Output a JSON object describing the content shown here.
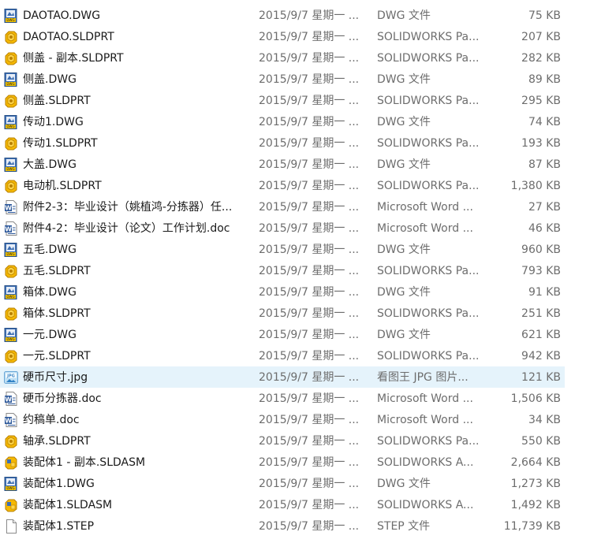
{
  "files": [
    {
      "name": "DAOTAO.DWG",
      "date": "2015/9/7 星期一 ...",
      "type": "DWG 文件",
      "size": "75 KB",
      "icon": "dwg-file-icon"
    },
    {
      "name": "DAOTAO.SLDPRT",
      "date": "2015/9/7 星期一 ...",
      "type": "SOLIDWORKS Pa...",
      "size": "207 KB",
      "icon": "solidworks-part-icon"
    },
    {
      "name": "侧盖 - 副本.SLDPRT",
      "date": "2015/9/7 星期一 ...",
      "type": "SOLIDWORKS Pa...",
      "size": "282 KB",
      "icon": "solidworks-part-icon"
    },
    {
      "name": "侧盖.DWG",
      "date": "2015/9/7 星期一 ...",
      "type": "DWG 文件",
      "size": "89 KB",
      "icon": "dwg-file-icon"
    },
    {
      "name": "侧盖.SLDPRT",
      "date": "2015/9/7 星期一 ...",
      "type": "SOLIDWORKS Pa...",
      "size": "295 KB",
      "icon": "solidworks-part-icon"
    },
    {
      "name": "传动1.DWG",
      "date": "2015/9/7 星期一 ...",
      "type": "DWG 文件",
      "size": "74 KB",
      "icon": "dwg-file-icon"
    },
    {
      "name": "传动1.SLDPRT",
      "date": "2015/9/7 星期一 ...",
      "type": "SOLIDWORKS Pa...",
      "size": "193 KB",
      "icon": "solidworks-part-icon"
    },
    {
      "name": "大盖.DWG",
      "date": "2015/9/7 星期一 ...",
      "type": "DWG 文件",
      "size": "87 KB",
      "icon": "dwg-file-icon"
    },
    {
      "name": "电动机.SLDPRT",
      "date": "2015/9/7 星期一 ...",
      "type": "SOLIDWORKS Pa...",
      "size": "1,380 KB",
      "icon": "solidworks-part-icon"
    },
    {
      "name": "附件2-3：毕业设计（姚植鸿-分拣器）任...",
      "date": "2015/9/7 星期一 ...",
      "type": "Microsoft Word ...",
      "size": "27 KB",
      "icon": "word-doc-icon"
    },
    {
      "name": "附件4-2：毕业设计（论文）工作计划.doc",
      "date": "2015/9/7 星期一 ...",
      "type": "Microsoft Word ...",
      "size": "46 KB",
      "icon": "word-doc-icon"
    },
    {
      "name": "五毛.DWG",
      "date": "2015/9/7 星期一 ...",
      "type": "DWG 文件",
      "size": "960 KB",
      "icon": "dwg-file-icon"
    },
    {
      "name": "五毛.SLDPRT",
      "date": "2015/9/7 星期一 ...",
      "type": "SOLIDWORKS Pa...",
      "size": "793 KB",
      "icon": "solidworks-part-icon"
    },
    {
      "name": "箱体.DWG",
      "date": "2015/9/7 星期一 ...",
      "type": "DWG 文件",
      "size": "91 KB",
      "icon": "dwg-file-icon"
    },
    {
      "name": "箱体.SLDPRT",
      "date": "2015/9/7 星期一 ...",
      "type": "SOLIDWORKS Pa...",
      "size": "251 KB",
      "icon": "solidworks-part-icon"
    },
    {
      "name": "一元.DWG",
      "date": "2015/9/7 星期一 ...",
      "type": "DWG 文件",
      "size": "621 KB",
      "icon": "dwg-file-icon"
    },
    {
      "name": "一元.SLDPRT",
      "date": "2015/9/7 星期一 ...",
      "type": "SOLIDWORKS Pa...",
      "size": "942 KB",
      "icon": "solidworks-part-icon"
    },
    {
      "name": "硬币尺寸.jpg",
      "date": "2015/9/7 星期一 ...",
      "type": "看图王 JPG 图片...",
      "size": "121 KB",
      "icon": "jpg-image-icon",
      "selected": true
    },
    {
      "name": "硬币分拣器.doc",
      "date": "2015/9/7 星期一 ...",
      "type": "Microsoft Word ...",
      "size": "1,506 KB",
      "icon": "word-doc-icon"
    },
    {
      "name": "约稿单.doc",
      "date": "2015/9/7 星期一 ...",
      "type": "Microsoft Word ...",
      "size": "34 KB",
      "icon": "word-doc-icon"
    },
    {
      "name": "轴承.SLDPRT",
      "date": "2015/9/7 星期一 ...",
      "type": "SOLIDWORKS Pa...",
      "size": "550 KB",
      "icon": "solidworks-part-icon"
    },
    {
      "name": "装配体1 - 副本.SLDASM",
      "date": "2015/9/7 星期一 ...",
      "type": "SOLIDWORKS A...",
      "size": "2,664 KB",
      "icon": "solidworks-assembly-icon"
    },
    {
      "name": "装配体1.DWG",
      "date": "2015/9/7 星期一 ...",
      "type": "DWG 文件",
      "size": "1,273 KB",
      "icon": "dwg-file-icon"
    },
    {
      "name": "装配体1.SLDASM",
      "date": "2015/9/7 星期一 ...",
      "type": "SOLIDWORKS A...",
      "size": "1,492 KB",
      "icon": "solidworks-assembly-icon"
    },
    {
      "name": "装配体1.STEP",
      "date": "2015/9/7 星期一 ...",
      "type": "STEP 文件",
      "size": "11,739 KB",
      "icon": "generic-file-icon"
    }
  ]
}
